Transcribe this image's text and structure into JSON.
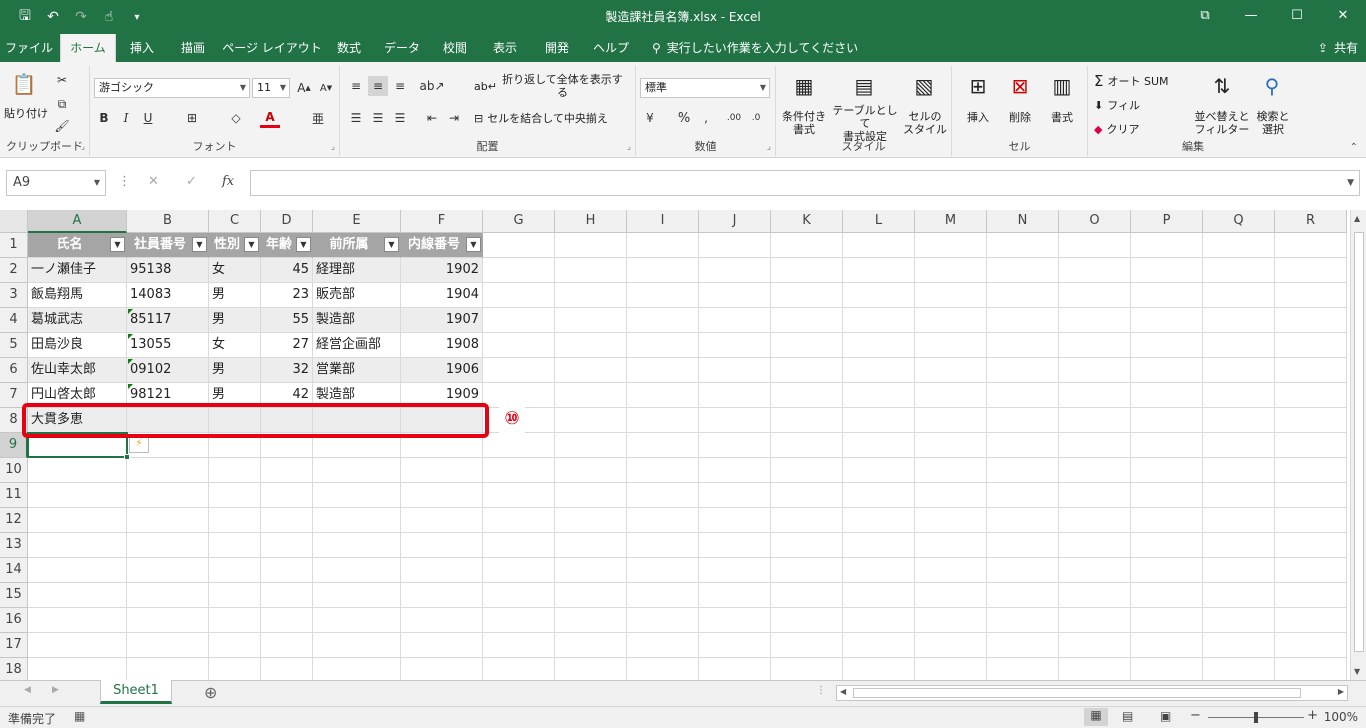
{
  "window": {
    "title": "製造課社員名簿.xlsx  -  Excel",
    "minimize": "—",
    "maximize": "☐",
    "close": "✕",
    "ribbon_display": "⧉"
  },
  "tabs": [
    "ファイル",
    "ホーム",
    "挿入",
    "描画",
    "ページ レイアウト",
    "数式",
    "データ",
    "校閲",
    "表示",
    "開発",
    "ヘルプ"
  ],
  "active_tab": "ホーム",
  "tell_me": "実行したい作業を入力してください",
  "share": "共有",
  "ribbon": {
    "clipboard": {
      "label": "クリップボード",
      "paste": "貼り付け"
    },
    "font": {
      "label": "フォント",
      "name": "游ゴシック",
      "size": "11",
      "bold": "B",
      "italic": "I",
      "underline": "U"
    },
    "alignment": {
      "label": "配置",
      "wrap": "折り返して全体を表示する",
      "merge": "セルを結合して中央揃え"
    },
    "number": {
      "label": "数値",
      "format": "標準",
      "percent": "%"
    },
    "styles": {
      "label": "スタイル",
      "conditional_1": "条件付き",
      "conditional_2": "書式",
      "table_1": "テーブルとして",
      "table_2": "書式設定",
      "cell_1": "セルの",
      "cell_2": "スタイル"
    },
    "cells": {
      "label": "セル",
      "insert": "挿入",
      "delete": "削除",
      "format": "書式"
    },
    "editing": {
      "label": "編集",
      "autosum": "オート SUM",
      "fill": "フィル",
      "clear": "クリア",
      "sort_1": "並べ替えと",
      "sort_2": "フィルター",
      "find_1": "検索と",
      "find_2": "選択"
    }
  },
  "formula_bar": {
    "name_box": "A9",
    "cancel": "✕",
    "enter": "✓",
    "fx": "fx",
    "value": ""
  },
  "columns": [
    "A",
    "B",
    "C",
    "D",
    "E",
    "F",
    "G",
    "H",
    "I",
    "J",
    "K",
    "L",
    "M",
    "N",
    "O",
    "P",
    "Q",
    "R"
  ],
  "rows": [
    "1",
    "2",
    "3",
    "4",
    "5",
    "6",
    "7",
    "8",
    "9",
    "10",
    "11",
    "12",
    "13",
    "14",
    "15",
    "16",
    "17",
    "18"
  ],
  "table": {
    "headers": [
      "氏名",
      "社員番号",
      "性別",
      "年齢",
      "前所属",
      "内線番号"
    ],
    "data": [
      [
        "一ノ瀬佳子",
        "95138",
        "女",
        "45",
        "経理部",
        "1902"
      ],
      [
        "飯島翔馬",
        "14083",
        "男",
        "23",
        "販売部",
        "1904"
      ],
      [
        "葛城武志",
        "85117",
        "男",
        "55",
        "製造部",
        "1907"
      ],
      [
        "田島沙良",
        "13055",
        "女",
        "27",
        "経営企画部",
        "1908"
      ],
      [
        "佐山幸太郎",
        "09102",
        "男",
        "32",
        "営業部",
        "1906"
      ],
      [
        "円山啓太郎",
        "98121",
        "男",
        "42",
        "製造部",
        "1909"
      ],
      [
        "大貫多恵",
        "",
        "",
        "",
        "",
        ""
      ]
    ]
  },
  "callout": "⑩",
  "sheet": {
    "name": "Sheet1",
    "add": "⊕"
  },
  "status": {
    "ready": "準備完了",
    "zoom": "100%"
  }
}
